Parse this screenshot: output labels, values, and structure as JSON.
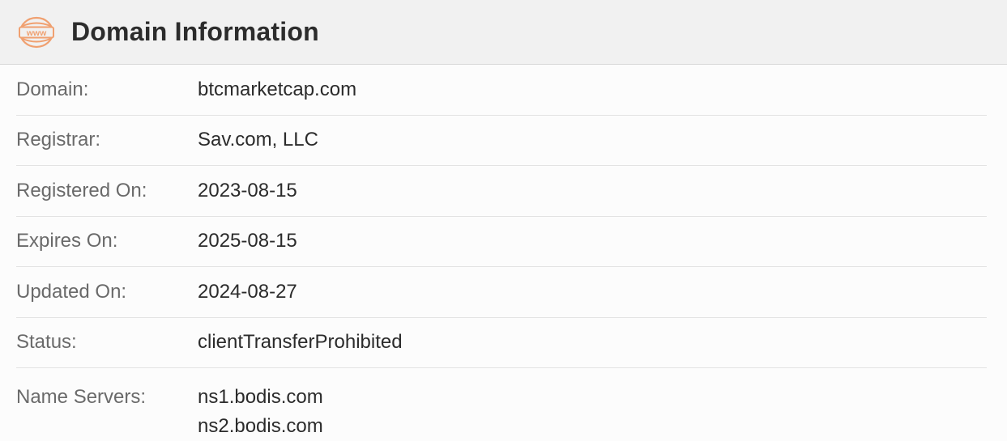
{
  "header": {
    "title": "Domain Information",
    "icon": "www-globe-icon",
    "icon_text": "www",
    "icon_color": "#f0a070"
  },
  "rows": [
    {
      "label": "Domain:",
      "value": "btcmarketcap.com"
    },
    {
      "label": "Registrar:",
      "value": "Sav.com, LLC"
    },
    {
      "label": "Registered On:",
      "value": "2023-08-15"
    },
    {
      "label": "Expires On:",
      "value": "2025-08-15"
    },
    {
      "label": "Updated On:",
      "value": "2024-08-27"
    },
    {
      "label": "Status:",
      "value": "clientTransferProhibited"
    }
  ],
  "name_servers": {
    "label": "Name Servers:",
    "values": [
      "ns1.bodis.com",
      "ns2.bodis.com"
    ]
  }
}
